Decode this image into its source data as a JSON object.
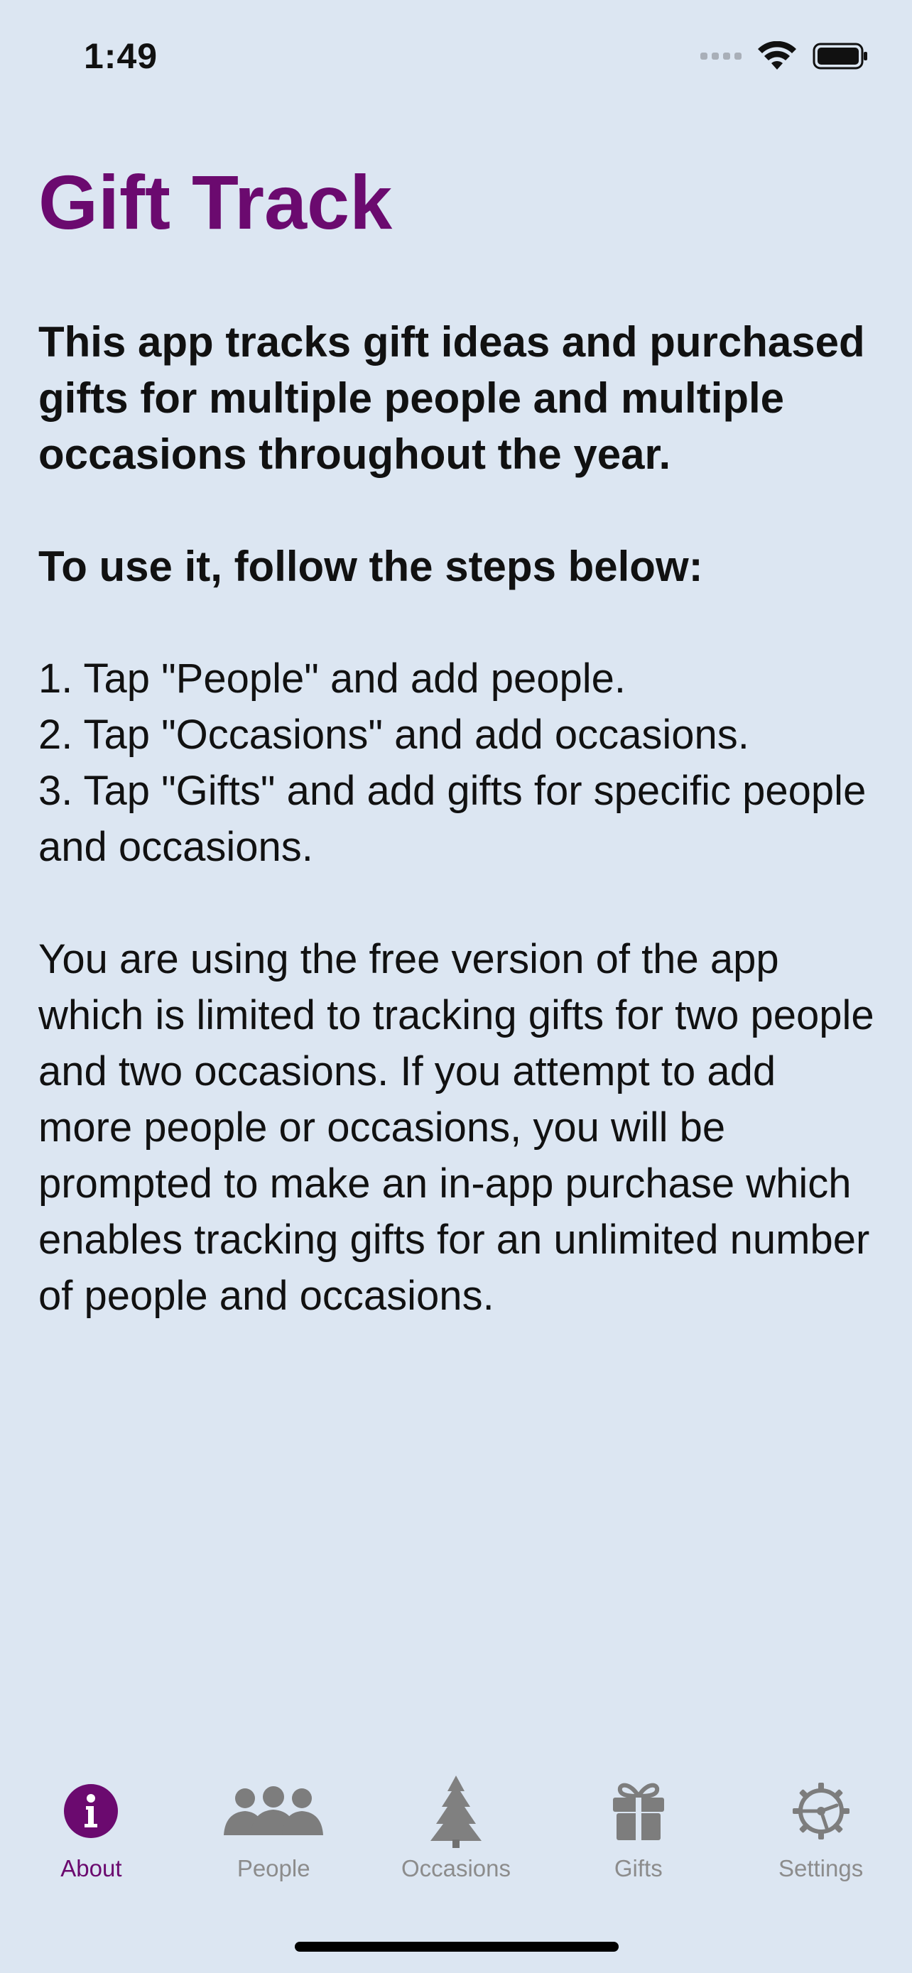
{
  "status_bar": {
    "time": "1:49"
  },
  "about": {
    "title": "Gift Track",
    "intro": "This app tracks gift ideas and purchased gifts for multiple people and multiple occasions throughout the year.",
    "steps_heading": "To use it, follow the steps below:",
    "steps": [
      "1. Tap \"People\" and add people.",
      "2. Tap \"Occasions\" and add occasions.",
      "3. Tap \"Gifts\" and add gifts for specific people and occasions."
    ],
    "notice": "You are using the free version of the app which is limited to tracking gifts for two people and two occasions. If you attempt to add more people or occasions, you will be prompted to make an in-app purchase which enables tracking gifts for an unlimited number of people and occasions."
  },
  "tab_bar": {
    "tabs": [
      {
        "label": "About",
        "icon": "info-icon",
        "active": true
      },
      {
        "label": "People",
        "icon": "people-icon",
        "active": false
      },
      {
        "label": "Occasions",
        "icon": "tree-icon",
        "active": false
      },
      {
        "label": "Gifts",
        "icon": "gift-icon",
        "active": false
      },
      {
        "label": "Settings",
        "icon": "gear-icon",
        "active": false
      }
    ]
  },
  "colors": {
    "accent": "#6b0a6f",
    "background": "#dce6f2",
    "inactive": "#8c8c8c"
  }
}
